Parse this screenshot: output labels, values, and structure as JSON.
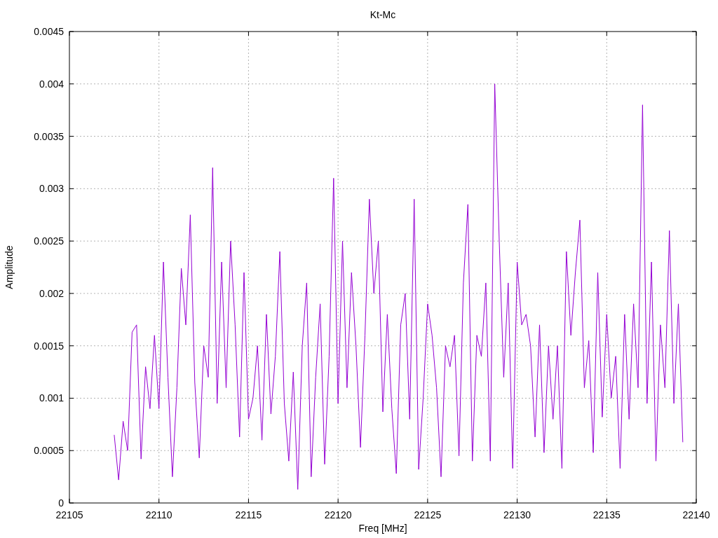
{
  "chart": {
    "chart_data": {
      "type": "line",
      "title": "Kt-Mc",
      "xlabel": "Freq [MHz]",
      "ylabel": "Amplitude",
      "grid": true,
      "xlim": [
        22105,
        22140
      ],
      "ylim": [
        0,
        0.0045
      ],
      "xticks": [
        22105,
        22110,
        22115,
        22120,
        22125,
        22130,
        22135,
        22140
      ],
      "yticks": [
        {
          "value": 0,
          "label": "0"
        },
        {
          "value": 0.0005,
          "label": "0.0005"
        },
        {
          "value": 0.001,
          "label": "0.001"
        },
        {
          "value": 0.0015,
          "label": "0.0015"
        },
        {
          "value": 0.002,
          "label": "0.002"
        },
        {
          "value": 0.0025,
          "label": "0.0025"
        },
        {
          "value": 0.003,
          "label": "0.003"
        },
        {
          "value": 0.0035,
          "label": "0.0035"
        },
        {
          "value": 0.004,
          "label": "0.004"
        },
        {
          "value": 0.0045,
          "label": "0.0045"
        }
      ],
      "x": [
        22107.5,
        22107.75,
        22108,
        22108.25,
        22108.5,
        22108.75,
        22109,
        22109.25,
        22109.5,
        22109.75,
        22110,
        22110.25,
        22110.5,
        22110.75,
        22111,
        22111.25,
        22111.5,
        22111.75,
        22112,
        22112.25,
        22112.5,
        22112.75,
        22113,
        22113.25,
        22113.5,
        22113.75,
        22114,
        22114.25,
        22114.5,
        22114.75,
        22115,
        22115.25,
        22115.5,
        22115.75,
        22116,
        22116.25,
        22116.5,
        22116.75,
        22117,
        22117.25,
        22117.5,
        22117.75,
        22118,
        22118.25,
        22118.5,
        22118.75,
        22119,
        22119.25,
        22119.5,
        22119.75,
        22120,
        22120.25,
        22120.5,
        22120.75,
        22121,
        22121.25,
        22121.5,
        22121.75,
        22122,
        22122.25,
        22122.5,
        22122.75,
        22123,
        22123.25,
        22123.5,
        22123.75,
        22124,
        22124.25,
        22124.5,
        22124.75,
        22125,
        22125.25,
        22125.5,
        22125.75,
        22126,
        22126.25,
        22126.5,
        22126.75,
        22127,
        22127.25,
        22127.5,
        22127.75,
        22128,
        22128.25,
        22128.5,
        22128.75,
        22129,
        22129.25,
        22129.5,
        22129.75,
        22130,
        22130.25,
        22130.5,
        22130.75,
        22131,
        22131.25,
        22131.5,
        22131.75,
        22132,
        22132.25,
        22132.5,
        22132.75,
        22133,
        22133.25,
        22133.5,
        22133.75,
        22134,
        22134.25,
        22134.5,
        22134.75,
        22135,
        22135.25,
        22135.5,
        22135.75,
        22136,
        22136.25,
        22136.5,
        22136.75,
        22137,
        22137.25,
        22137.5,
        22137.75,
        22138,
        22138.25,
        22138.5,
        22138.75,
        22139,
        22139.25
      ],
      "series": [
        {
          "color": "#9400d3",
          "values": [
            0.00065,
            0.00022,
            0.00078,
            0.0005,
            0.00163,
            0.0017,
            0.00042,
            0.0013,
            0.0009,
            0.0016,
            0.0009,
            0.0023,
            0.0012,
            0.00025,
            0.0011,
            0.00224,
            0.0017,
            0.00275,
            0.00115,
            0.00043,
            0.0015,
            0.0012,
            0.0032,
            0.00095,
            0.0023,
            0.0011,
            0.0025,
            0.0017,
            0.00063,
            0.0022,
            0.0008,
            0.001,
            0.0015,
            0.0006,
            0.0018,
            0.00085,
            0.0014,
            0.0024,
            0.00095,
            0.0004,
            0.00125,
            0.00013,
            0.0015,
            0.0021,
            0.00025,
            0.0012,
            0.0019,
            0.00037,
            0.0014,
            0.0031,
            0.00095,
            0.0025,
            0.0011,
            0.0022,
            0.0015,
            0.00053,
            0.0016,
            0.0029,
            0.002,
            0.0025,
            0.00087,
            0.0018,
            0.0009,
            0.00028,
            0.0017,
            0.002,
            0.0008,
            0.0029,
            0.00032,
            0.001,
            0.0019,
            0.0016,
            0.0011,
            0.00025,
            0.0015,
            0.0013,
            0.0016,
            0.00045,
            0.0021,
            0.00285,
            0.0004,
            0.0016,
            0.0014,
            0.0021,
            0.0004,
            0.004,
            0.0025,
            0.0012,
            0.0021,
            0.00033,
            0.0023,
            0.0017,
            0.0018,
            0.0015,
            0.00063,
            0.0017,
            0.00048,
            0.0015,
            0.0008,
            0.0015,
            0.00033,
            0.0024,
            0.0016,
            0.0022,
            0.0027,
            0.0011,
            0.00155,
            0.00048,
            0.0022,
            0.00082,
            0.0018,
            0.001,
            0.0014,
            0.00033,
            0.0018,
            0.0008,
            0.0019,
            0.0011,
            0.0038,
            0.00095,
            0.0023,
            0.0004,
            0.0017,
            0.0011,
            0.0026,
            0.00095,
            0.0019,
            0.00058
          ]
        }
      ]
    }
  }
}
